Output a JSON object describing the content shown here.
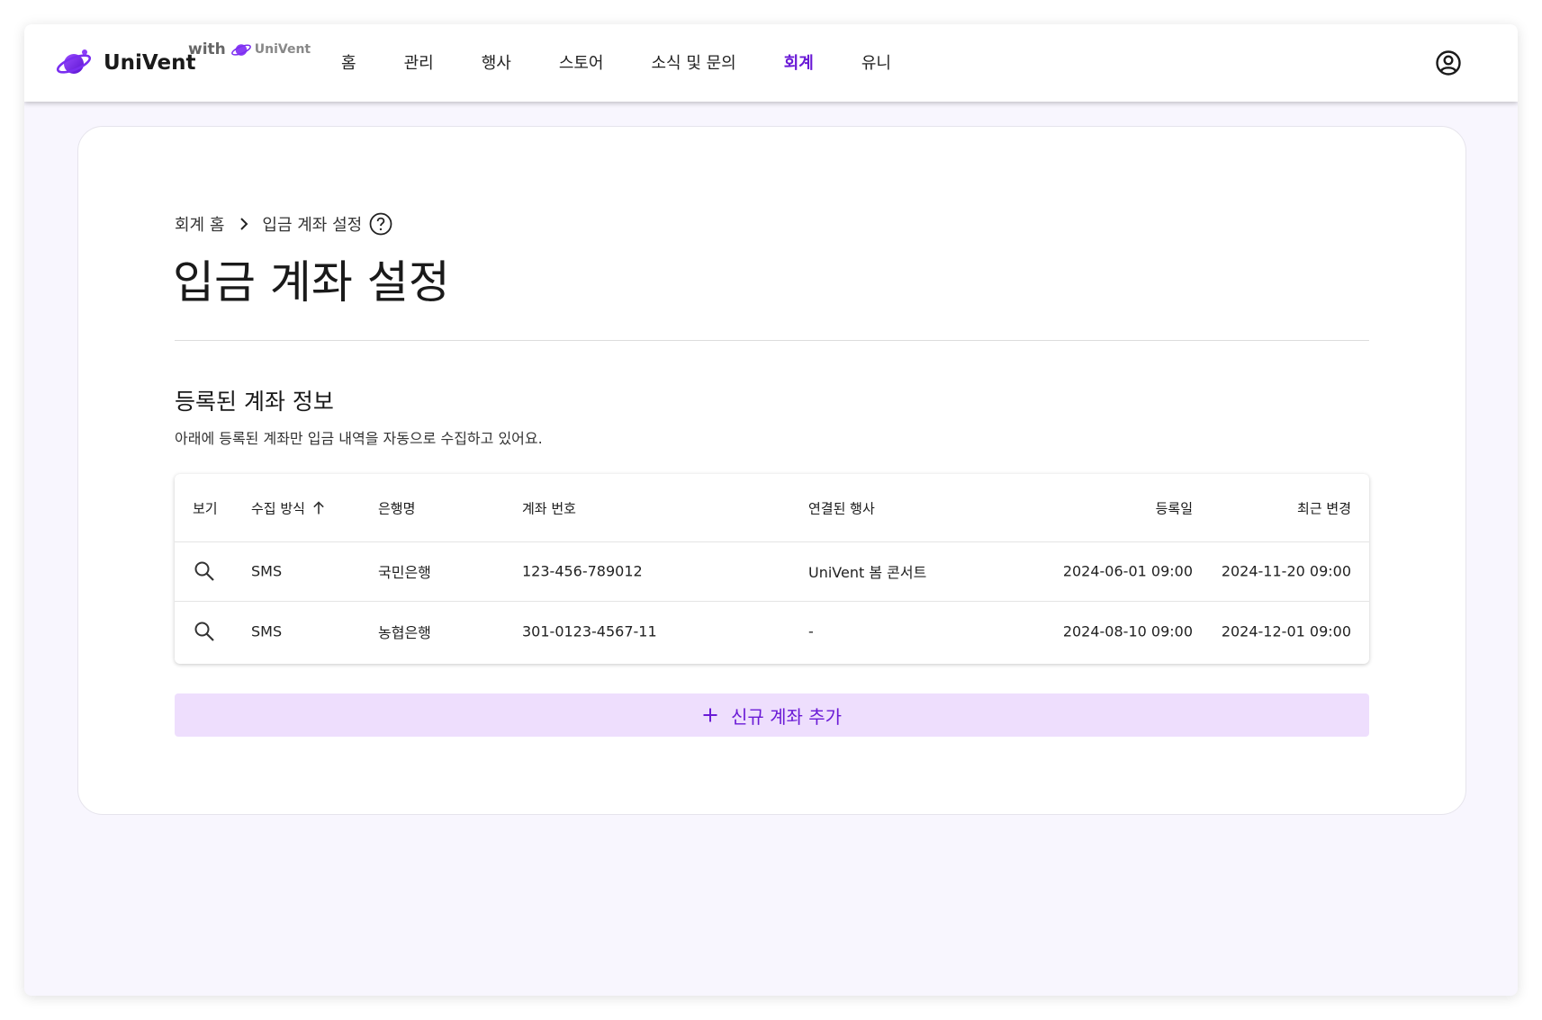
{
  "header": {
    "brand_name": "UniVent",
    "with_text": "with",
    "with_brand": "UniVent",
    "nav": [
      {
        "label": "홈",
        "active": false
      },
      {
        "label": "관리",
        "active": false
      },
      {
        "label": "행사",
        "active": false
      },
      {
        "label": "스토어",
        "active": false
      },
      {
        "label": "소식 및 문의",
        "active": false
      },
      {
        "label": "회계",
        "active": true
      },
      {
        "label": "유니",
        "active": false
      }
    ],
    "account_icon": "account-circle-icon"
  },
  "breadcrumb": {
    "parent": "회계 홈",
    "current": "입금 계좌 설정"
  },
  "page_title": "입금 계좌 설정",
  "section": {
    "title": "등록된 계좌 정보",
    "description": "아래에 등록된 계좌만 입금 내역을 자동으로 수집하고 있어요."
  },
  "table": {
    "columns": {
      "view": "보기",
      "method": "수집 방식",
      "bank": "은행명",
      "account": "계좌 번호",
      "event": "연결된 행사",
      "registered": "등록일",
      "modified": "최근 변경"
    },
    "sort": {
      "column": "method",
      "direction": "ascending"
    },
    "rows": [
      {
        "method": "SMS",
        "bank": "국민은행",
        "account": "123-456-789012",
        "event": "UniVent 봄 콘서트",
        "registered": "2024-06-01 09:00",
        "modified": "2024-11-20 09:00"
      },
      {
        "method": "SMS",
        "bank": "농협은행",
        "account": "301-0123-4567-11",
        "event": "-",
        "registered": "2024-08-10 09:00",
        "modified": "2024-12-01 09:00"
      }
    ]
  },
  "add_button_label": "신규 계좌 추가",
  "colors": {
    "accent": "#6a1ad6",
    "accent_light": "#eedefd",
    "background": "#f8f6fe"
  }
}
